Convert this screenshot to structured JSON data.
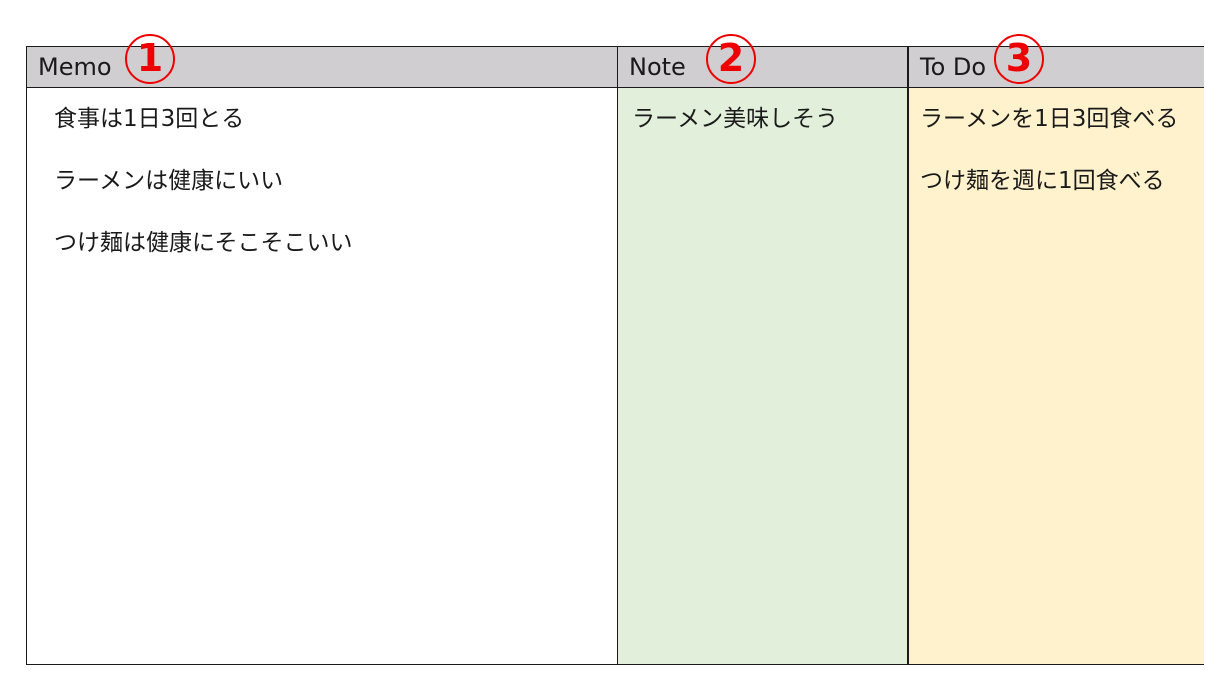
{
  "columns": [
    {
      "title": "Memo",
      "number": "1",
      "background": "#ffffff",
      "items": [
        "食事は1日3回とる",
        "ラーメンは健康にいい",
        "つけ麺は健康にそこそこいい"
      ]
    },
    {
      "title": "Note",
      "number": "2",
      "background": "#e2efda",
      "items": [
        "ラーメン美味しそう"
      ]
    },
    {
      "title": "To Do",
      "number": "3",
      "background": "#fff2cc",
      "items": [
        "ラーメンを1日3回食べる",
        "つけ麺を週に1回食べる"
      ]
    }
  ],
  "colors": {
    "header_background": "#d0ced0",
    "number_accent": "#ee0000",
    "border": "#1a1a1a"
  }
}
